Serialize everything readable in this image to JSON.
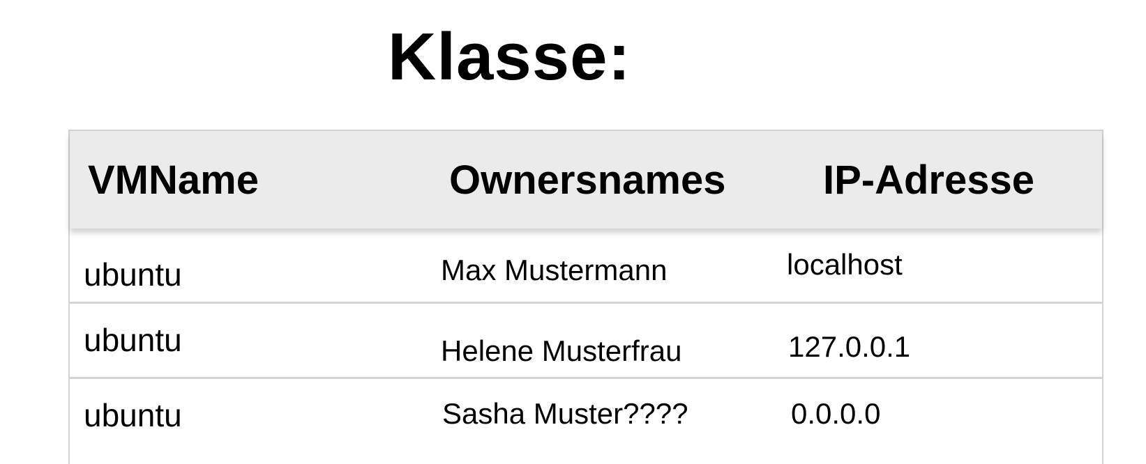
{
  "page": {
    "title": "Klasse:"
  },
  "table": {
    "columns": [
      "VMName",
      "Ownersnames",
      "IP-Adresse"
    ],
    "rows": [
      {
        "vm_name": "ubuntu",
        "owner": "Max Mustermann",
        "ip": "localhost"
      },
      {
        "vm_name": "ubuntu",
        "owner": "Helene Musterfrau",
        "ip": "127.0.0.1"
      },
      {
        "vm_name": "ubuntu",
        "owner": "Sasha Muster????",
        "ip": "0.0.0.0"
      }
    ]
  },
  "colors": {
    "header_background": "#ebebeb",
    "border": "#d4d4d4",
    "text": "#000000",
    "background": "#ffffff"
  }
}
